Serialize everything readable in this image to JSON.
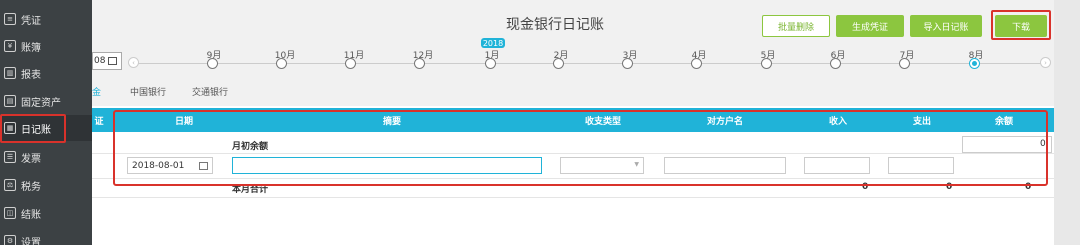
{
  "sidebar": {
    "items": [
      {
        "label": "凭证",
        "icon": "voucher-icon",
        "glyph": "≡"
      },
      {
        "label": "账簿",
        "icon": "ledger-icon",
        "glyph": "¥"
      },
      {
        "label": "报表",
        "icon": "report-chart-icon",
        "glyph": "▥"
      },
      {
        "label": "固定资产",
        "icon": "fixed-asset-icon",
        "glyph": "▤"
      },
      {
        "label": "日记账",
        "icon": "journal-icon",
        "glyph": "▦"
      },
      {
        "label": "发票",
        "icon": "invoice-icon",
        "glyph": "☰"
      },
      {
        "label": "税务",
        "icon": "tax-icon",
        "glyph": "⚖"
      },
      {
        "label": "结账",
        "icon": "closing-icon",
        "glyph": "◫"
      },
      {
        "label": "设置",
        "icon": "settings-icon",
        "glyph": "⚙"
      }
    ],
    "active": "日记账"
  },
  "header": {
    "title": "现金银行日记账",
    "buttons": {
      "batch_delete": "批量删除",
      "generate_voucher": "生成凭证",
      "import_journal": "导入日记账",
      "download": "下载"
    }
  },
  "timeline": {
    "date_input": "08",
    "year": "2018",
    "months": [
      "9月",
      "10月",
      "11月",
      "12月",
      "1月",
      "2月",
      "3月",
      "4月",
      "5月",
      "6月",
      "7月",
      "8月"
    ],
    "current_month": "8月"
  },
  "accounts": {
    "tabs": [
      "金",
      "中国银行",
      "交通银行"
    ],
    "current": "金"
  },
  "table": {
    "columns": [
      "证",
      "日期",
      "摘要",
      "收支类型",
      "对方户名",
      "收入",
      "支出",
      "余额"
    ],
    "opening_row": {
      "summary": "月初余额",
      "balance": "0"
    },
    "entry_row": {
      "date": "2018-08-01",
      "summary": "",
      "type": "",
      "counterparty": "",
      "income": "",
      "expense": ""
    },
    "total_row": {
      "label": "本月合计",
      "income": "0",
      "expense": "0",
      "balance": "0"
    }
  },
  "colors": {
    "accent": "#20b3d8",
    "green": "#8cc63f",
    "highlight": "#d9322b",
    "sidebar": "#3c4144"
  }
}
